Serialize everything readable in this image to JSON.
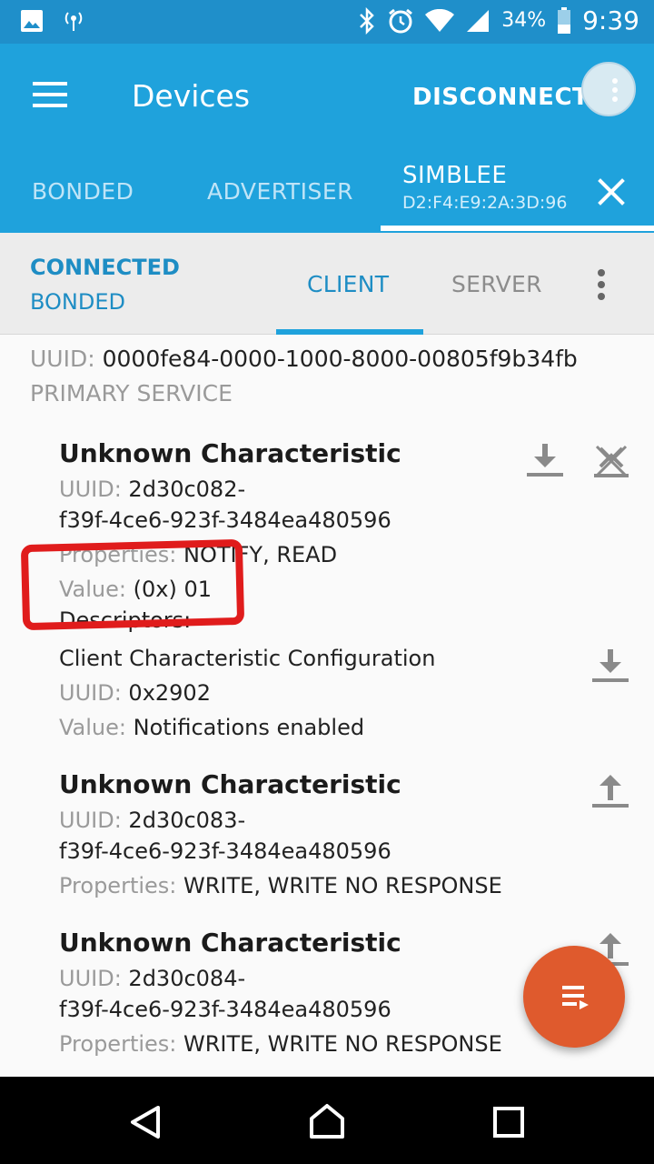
{
  "status_bar": {
    "battery": "34%",
    "time": "9:39",
    "icons": [
      "image-icon",
      "signal-broadcast-icon",
      "bluetooth-icon",
      "alarm-icon",
      "wifi-icon",
      "cell-signal-icon",
      "battery-icon"
    ]
  },
  "app_bar": {
    "title": "Devices",
    "disconnect_label": "DISCONNECT",
    "tabs": [
      {
        "label": "BONDED"
      },
      {
        "label": "ADVERTISER"
      }
    ],
    "device_tab": {
      "name": "SIMBLEE",
      "address": "D2:F4:E9:2A:3D:96"
    }
  },
  "connection": {
    "state": "CONNECTED",
    "bond": "BONDED",
    "tabs": [
      {
        "label": "CLIENT",
        "selected": true
      },
      {
        "label": "SERVER",
        "selected": false
      }
    ]
  },
  "service": {
    "uuid_label": "UUID:",
    "uuid": "0000fe84-0000-1000-8000-00805f9b34fb",
    "type": "PRIMARY SERVICE"
  },
  "characteristics": [
    {
      "name": "Unknown Characteristic",
      "uuid_label": "UUID:",
      "uuid_line1": "2d30c082-",
      "uuid_line2": "f39f-4ce6-923f-3484ea480596",
      "properties_label": "Properties:",
      "properties": "NOTIFY, READ",
      "value_label": "Value:",
      "value": "(0x) 01",
      "descriptors_label": "Descriptors:",
      "descriptor": {
        "name": "Client Characteristic Configuration",
        "uuid_label": "UUID:",
        "uuid": "0x2902",
        "value_label": "Value:",
        "value": "Notifications enabled"
      }
    },
    {
      "name": "Unknown Characteristic",
      "uuid_label": "UUID:",
      "uuid_line1": "2d30c083-",
      "uuid_line2": "f39f-4ce6-923f-3484ea480596",
      "properties_label": "Properties:",
      "properties": "WRITE, WRITE NO RESPONSE"
    },
    {
      "name": "Unknown Characteristic",
      "uuid_label": "UUID:",
      "uuid_line1": "2d30c084-",
      "uuid_line2": "f39f-4ce6-923f-3484ea480596",
      "properties_label": "Properties:",
      "properties": "WRITE, WRITE NO RESPONSE"
    }
  ],
  "colors": {
    "primary": "#1fa2dc",
    "status_bar": "#1f8fca",
    "accent": "#1e8dc4",
    "fab": "#df5a2d",
    "annotation": "#e01c1c"
  }
}
